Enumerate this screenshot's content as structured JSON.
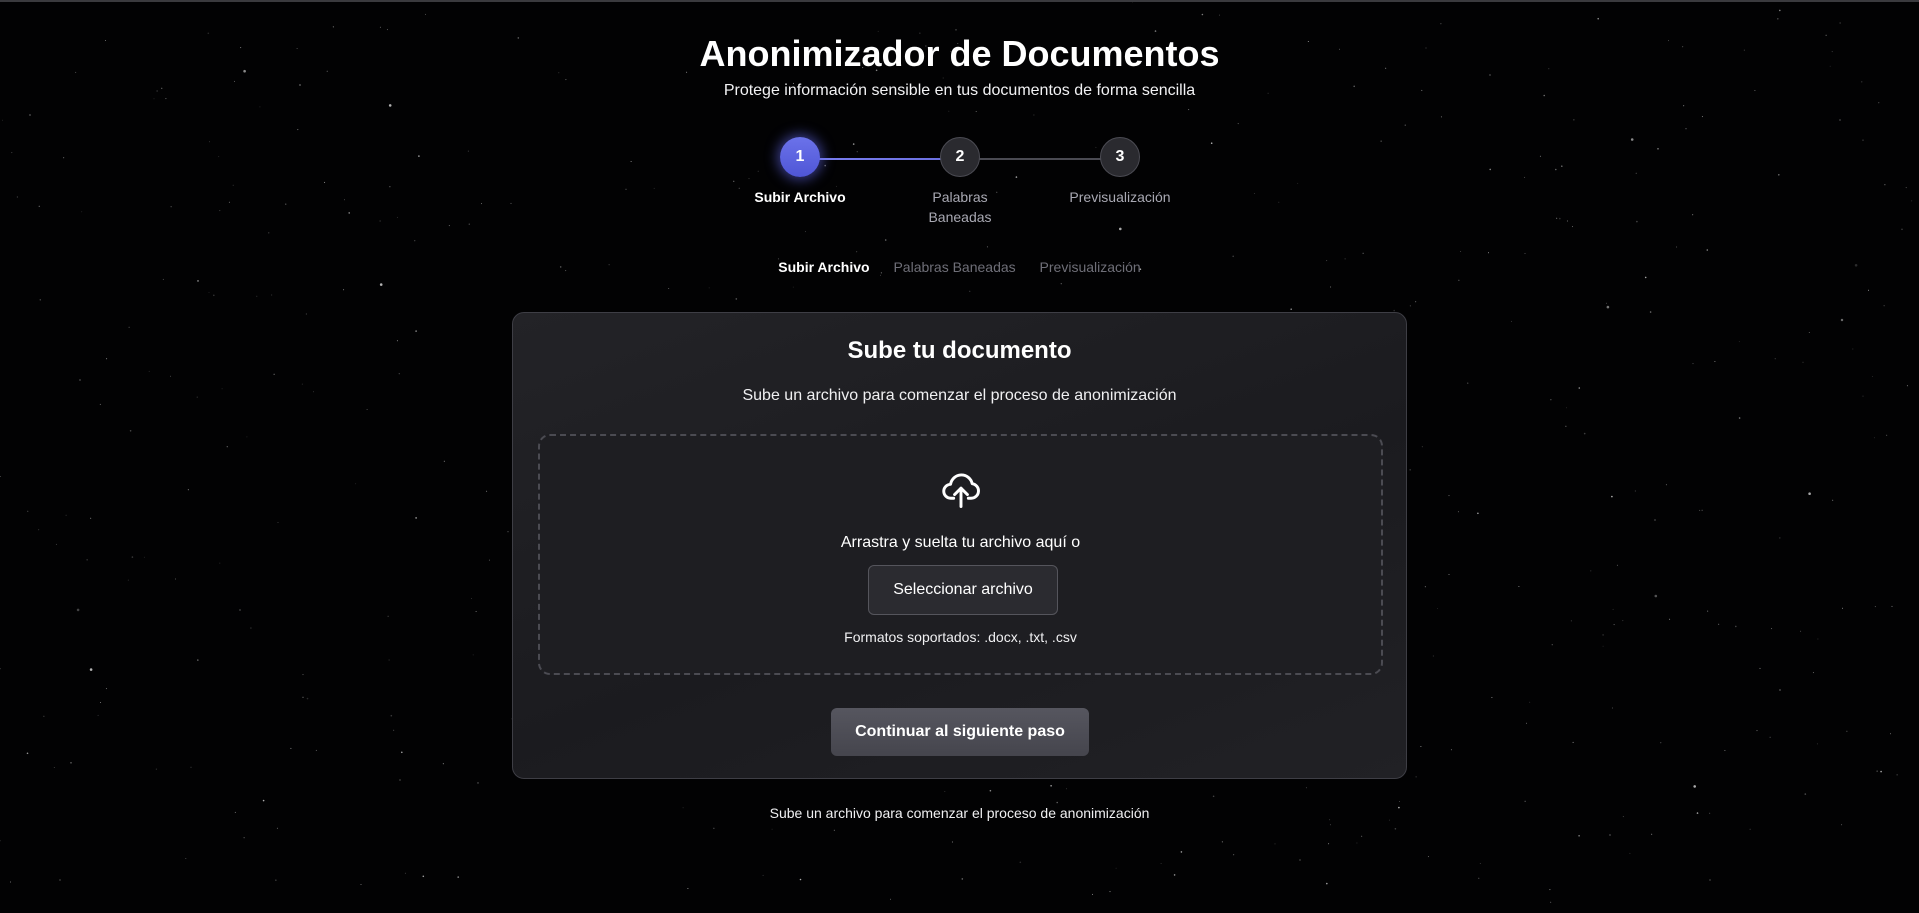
{
  "header": {
    "title": "Anonimizador de Documentos",
    "subtitle": "Protege información sensible en tus documentos de forma sencilla"
  },
  "stepper": {
    "active_index": 0,
    "steps": [
      {
        "number": "1",
        "label": "Subir Archivo"
      },
      {
        "number": "2",
        "label": "Palabras Baneadas"
      },
      {
        "number": "3",
        "label": "Previsualización"
      }
    ]
  },
  "tabs": [
    {
      "label": "Subir Archivo",
      "active": true
    },
    {
      "label": "Palabras Baneadas",
      "active": false
    },
    {
      "label": "Previsualización",
      "active": false
    }
  ],
  "card": {
    "title": "Sube tu documento",
    "description": "Sube un archivo para comenzar el proceso de anonimización",
    "dropzone": {
      "icon": "cloud-upload-icon",
      "text": "Arrastra y suelta tu archivo aquí o",
      "select_button": "Seleccionar archivo",
      "formats": "Formatos soportados: .docx, .txt, .csv"
    },
    "continue_button": "Continuar al siguiente paso"
  },
  "footer": {
    "hint": "Sube un archivo para comenzar el proceso de anonimización"
  },
  "colors": {
    "accent": "#5a61e0",
    "background": "#020203",
    "card": "#1f1f23"
  }
}
